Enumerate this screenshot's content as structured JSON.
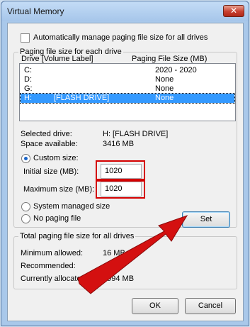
{
  "window": {
    "title": "Virtual Memory",
    "close_glyph": "✕"
  },
  "auto_manage": {
    "label": "Automatically manage paging file size for all drives",
    "checked": false
  },
  "paging_group": {
    "title": "Paging file size for each drive",
    "col_drive": "Drive  [Volume Label]",
    "col_size": "Paging File Size (MB)",
    "drives": [
      {
        "drive": "C:",
        "label": "",
        "size": "2020 - 2020"
      },
      {
        "drive": "D:",
        "label": "",
        "size": "None"
      },
      {
        "drive": "G:",
        "label": "",
        "size": "None"
      },
      {
        "drive": "H:",
        "label": "[FLASH DRIVE]",
        "size": "None",
        "selected": true
      }
    ],
    "selected_drive_label": "Selected drive:",
    "selected_drive_value": "H:  [FLASH DRIVE]",
    "space_available_label": "Space available:",
    "space_available_value": "3416 MB",
    "custom_size_label": "Custom size:",
    "initial_size_label": "Initial size (MB):",
    "initial_size_value": "1020",
    "maximum_size_label": "Maximum size (MB):",
    "maximum_size_value": "1020",
    "system_managed_label": "System managed size",
    "no_paging_label": "No paging file",
    "set_label": "Set"
  },
  "total_group": {
    "title": "Total paging file size for all drives",
    "minimum_label": "Minimum allowed:",
    "minimum_value": "16 MB",
    "recommended_label": "Recommended:",
    "recommended_value": "",
    "current_label": "Currently allocated:",
    "current_value": "2994 MB"
  },
  "footer": {
    "ok_label": "OK",
    "cancel_label": "Cancel"
  },
  "annotation": {
    "arrow_color": "#d41010",
    "highlight_color": "#d40000"
  }
}
